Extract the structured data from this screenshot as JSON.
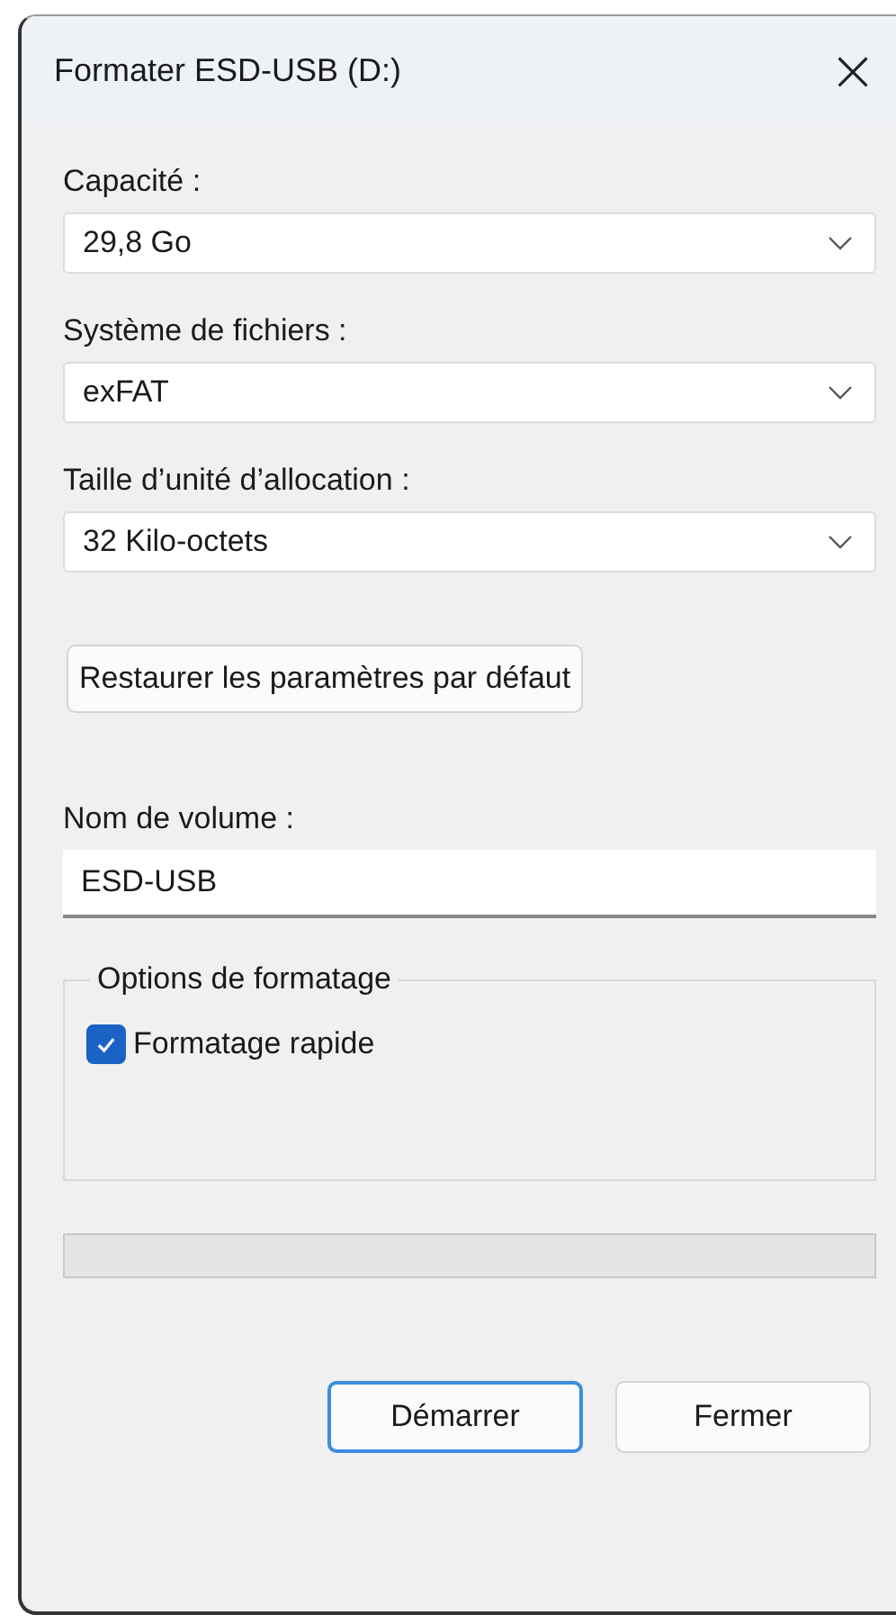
{
  "window": {
    "title": "Formater ESD-USB (D:)",
    "close": "×"
  },
  "fields": [
    {
      "kind": "dropdown",
      "label": "Capacité :",
      "value": "29,8 Go"
    },
    {
      "kind": "dropdown",
      "label": "Système de fichiers :",
      "value": "exFAT"
    },
    {
      "kind": "dropdown",
      "label": "Taille d’unité d’allocation :",
      "value": "32 Kilo-octets"
    }
  ],
  "restore_button": "Restaurer les paramètres par défaut",
  "volume": {
    "label": "Nom de volume :",
    "value": "ESD-USB"
  },
  "options": {
    "title": "Options de formatage",
    "items": [
      {
        "label": "Formatage rapide",
        "checked": true
      }
    ]
  },
  "progress": {
    "level": 0
  },
  "buttons": [
    {
      "label": "Démarrer",
      "default": true
    },
    {
      "label": "Fermer",
      "default": false
    }
  ]
}
